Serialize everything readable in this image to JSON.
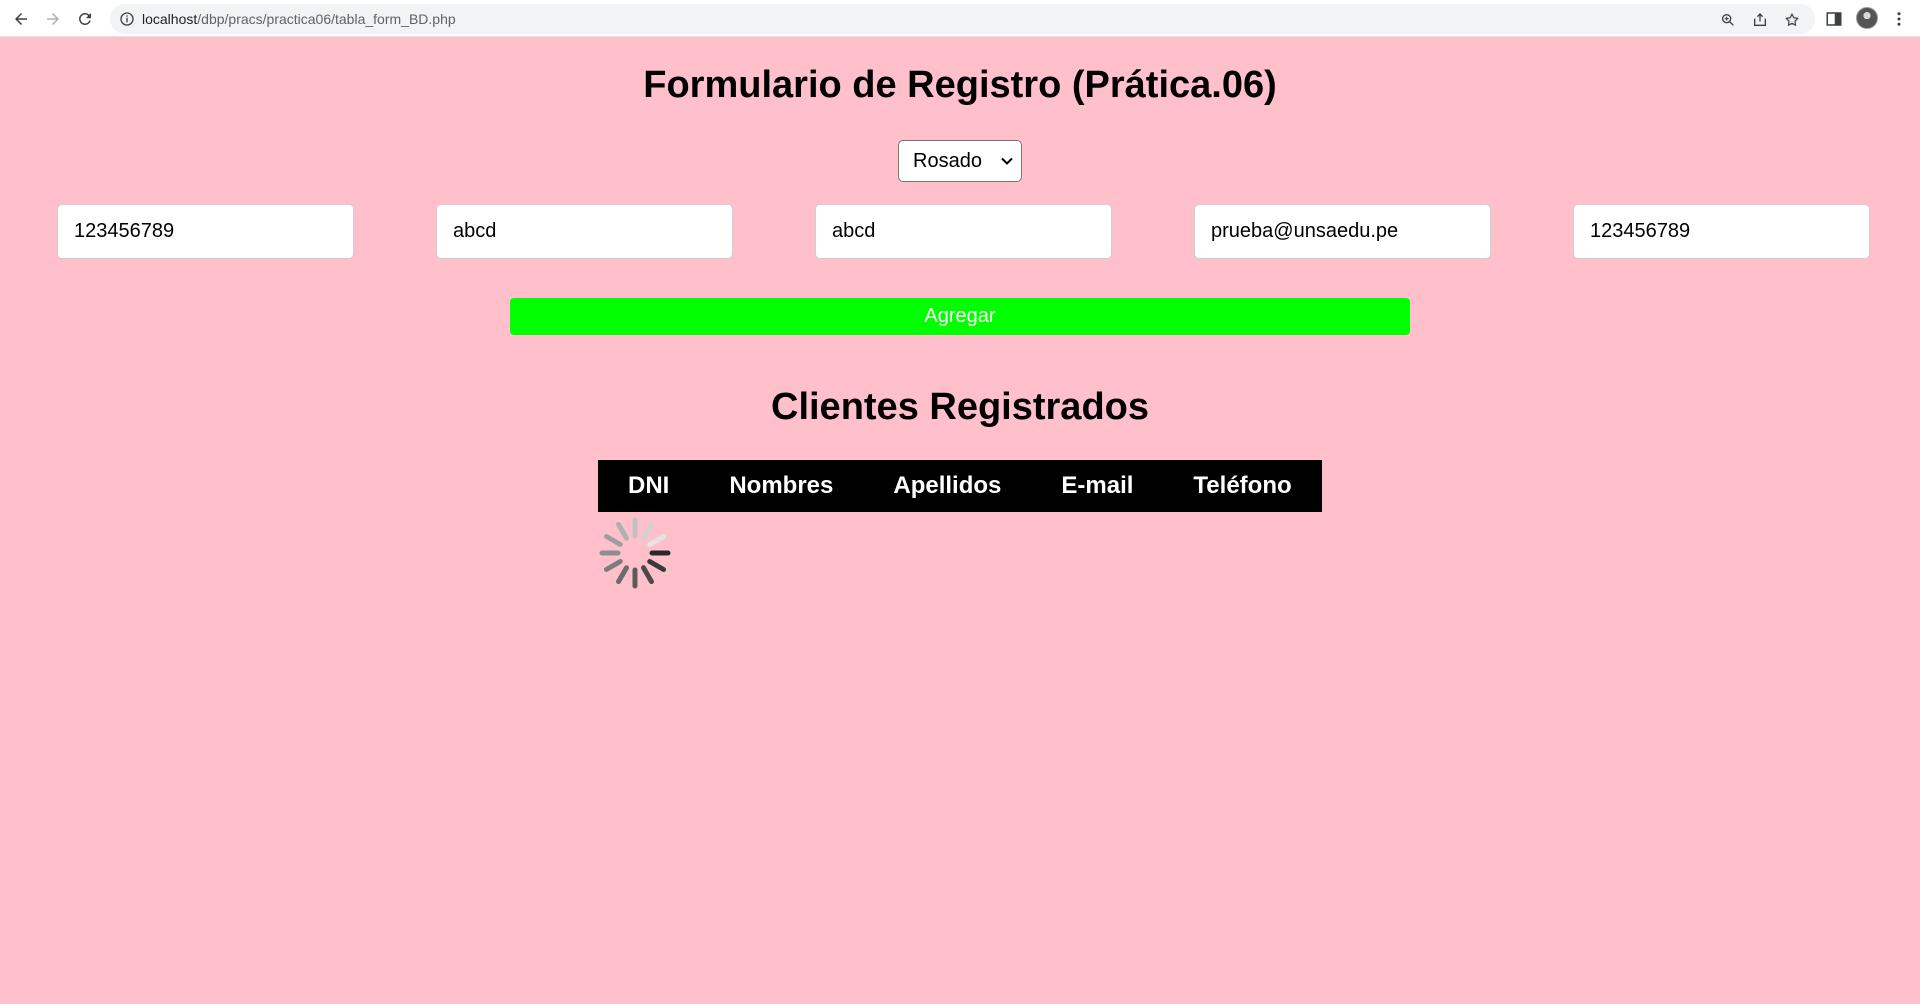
{
  "browser": {
    "url_host": "localhost",
    "url_path": "/dbp/pracs/practica06/tabla_form_BD.php",
    "icons": [
      "back-arrow-icon",
      "forward-arrow-icon",
      "reload-icon",
      "info-icon",
      "zoom-icon",
      "share-icon",
      "star-icon",
      "side-panel-icon",
      "avatar",
      "menu-dots-icon"
    ]
  },
  "page": {
    "title": "Formulario de Registro (Prática.06)",
    "background_color": "#ffc0cb"
  },
  "theme_select": {
    "selected": "Rosado"
  },
  "form": {
    "fields": [
      {
        "name": "dni",
        "value": "123456789"
      },
      {
        "name": "nombres",
        "value": "abcd"
      },
      {
        "name": "apellidos",
        "value": "abcd"
      },
      {
        "name": "email",
        "value": "prueba@unsaedu.pe"
      },
      {
        "name": "telefono",
        "value": "123456789"
      }
    ],
    "submit_label": "Agregar",
    "submit_color": "#00ff00"
  },
  "clients": {
    "title": "Clientes Registrados",
    "columns": [
      "DNI",
      "Nombres",
      "Apellidos",
      "E-mail",
      "Teléfono"
    ],
    "rows": [],
    "loading": true
  }
}
